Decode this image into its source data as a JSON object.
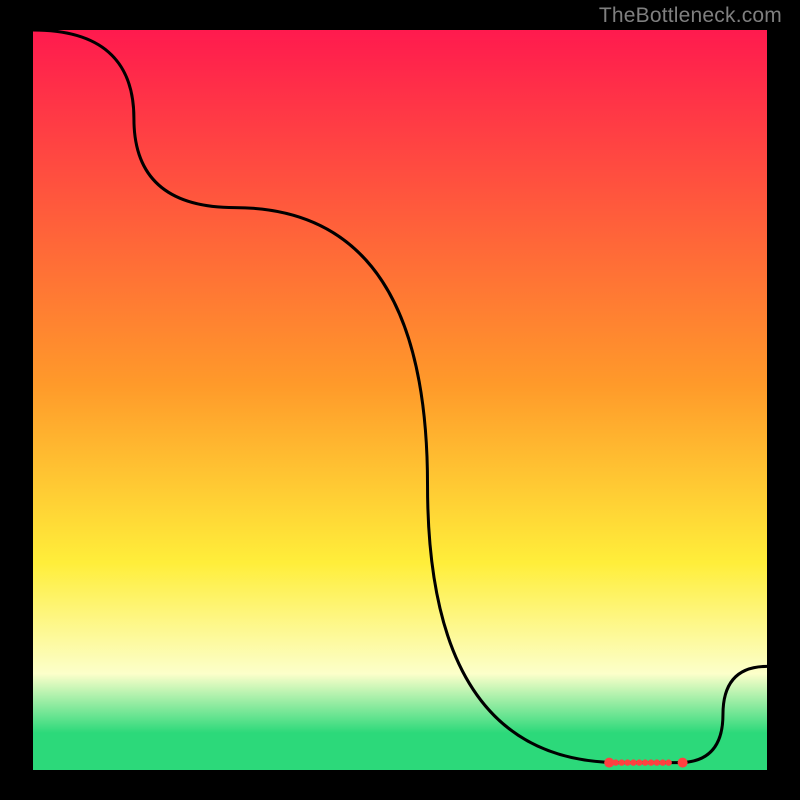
{
  "attribution": "TheBottleneck.com",
  "colors": {
    "curve": "#000000",
    "marker": "#ff4040",
    "background_black": "#000000",
    "grad_top": "#ff1a4e",
    "grad_mid1": "#ff9a2a",
    "grad_mid2": "#ffee3a",
    "grad_pale": "#fcffca",
    "grad_green": "#2cd97a"
  },
  "chart_data": {
    "type": "line",
    "title": "",
    "xlabel": "",
    "ylabel": "",
    "xlim": [
      0,
      100
    ],
    "ylim": [
      0,
      100
    ],
    "grid": false,
    "grad_stops": [
      {
        "pct": 0,
        "color": "#ff1a4e"
      },
      {
        "pct": 48,
        "color": "#ff9a2a"
      },
      {
        "pct": 72,
        "color": "#ffee3a"
      },
      {
        "pct": 87,
        "color": "#fcffca"
      },
      {
        "pct": 95,
        "color": "#2cd97a"
      }
    ],
    "series": [
      {
        "name": "curve",
        "x": [
          0,
          27.5,
          80,
          88,
          100
        ],
        "y": [
          100,
          76,
          1,
          1,
          14
        ]
      }
    ],
    "markers": {
      "name": "cluster",
      "x": [
        78.5,
        79.4,
        80.2,
        81.0,
        81.8,
        82.6,
        83.4,
        84.2,
        85.0,
        85.8,
        86.6,
        88.5
      ],
      "y": [
        1.0,
        1.0,
        1.0,
        1.0,
        1.0,
        1.0,
        1.0,
        1.0,
        1.0,
        1.0,
        1.0,
        1.0
      ]
    }
  }
}
